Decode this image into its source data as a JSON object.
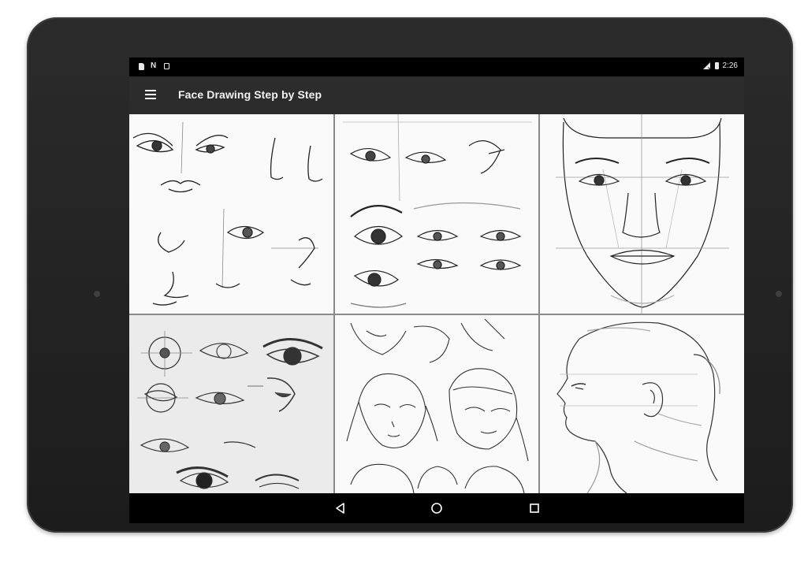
{
  "status_bar": {
    "time": "2:26",
    "left_icons": [
      "sd-card-icon",
      "n-notification-icon",
      "download-icon"
    ],
    "right_icons": [
      "wifi-icon",
      "battery-icon"
    ]
  },
  "app_bar": {
    "menu_icon": "hamburger-menu-icon",
    "title": "Face Drawing Step by Step"
  },
  "gallery": {
    "tiles": [
      {
        "subject": "eyes-and-noses-sketch"
      },
      {
        "subject": "eye-variations-sketch"
      },
      {
        "subject": "front-face-proportions-sketch"
      },
      {
        "subject": "eye-construction-sketch"
      },
      {
        "subject": "anime-girl-faces-sketch"
      },
      {
        "subject": "side-profile-head-sketch"
      }
    ]
  },
  "nav_bar": {
    "buttons": [
      "back-icon",
      "home-icon",
      "recents-icon"
    ]
  },
  "colors": {
    "app_bar_bg": "#2c2c2c",
    "status_bar_bg": "#000000",
    "frame": "#1f1f1f",
    "tile_border": "#8a8a8a"
  }
}
